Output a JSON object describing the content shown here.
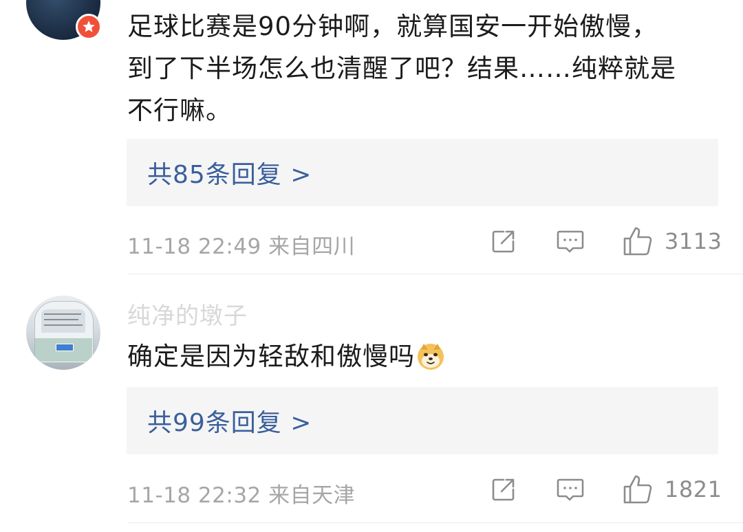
{
  "comments": [
    {
      "username": "",
      "text_lines": [
        "足球比赛是90分钟啊，就算国安一开始傲慢，",
        "到了下半场怎么也清醒了吧？结果……纯粹就是",
        "不行嘛。"
      ],
      "reply_link": "共85条回复 >",
      "timestamp": "11-18 22:49",
      "location": "来自四川",
      "like_count": "3113",
      "badge_icon": "vip-star-icon"
    },
    {
      "username": "纯净的墩子",
      "text": "确定是因为轻敌和傲慢吗",
      "emoji": "doge-emoji-icon",
      "reply_link": "共99条回复 >",
      "timestamp": "11-18 22:32",
      "location": "来自天津",
      "like_count": "1821"
    }
  ],
  "icons": {
    "share": "share-icon",
    "comment": "comment-icon",
    "like": "thumbs-up-icon"
  },
  "colors": {
    "reply_link": "#3a5f9b",
    "reply_bg": "#f5f5f6",
    "meta_text": "#a6a6a6",
    "badge": "#f0503a"
  }
}
